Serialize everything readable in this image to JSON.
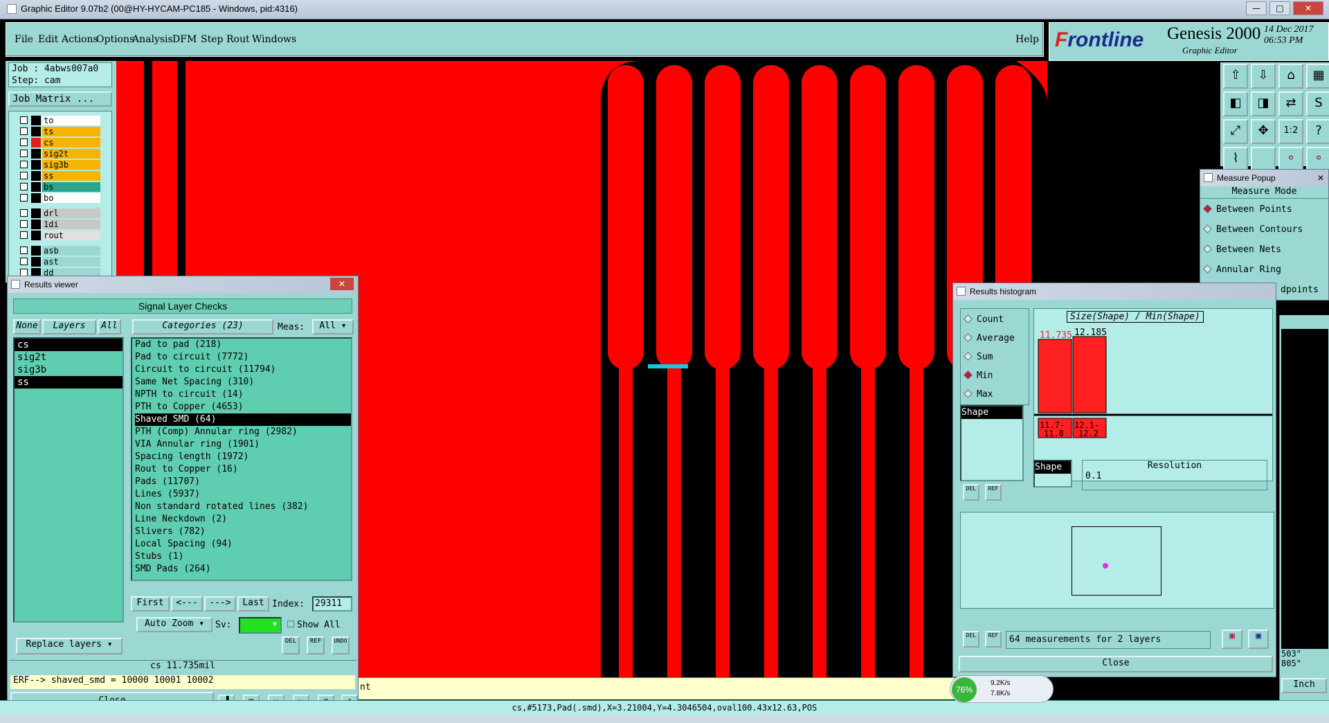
{
  "window": {
    "title": "Graphic Editor 9.07b2 (00@HY-HYCAM-PC185 - Windows, pid:4316)"
  },
  "menu": [
    "File",
    "Edit",
    "Actions",
    "Options",
    "Analysis",
    "DFM",
    "Step",
    "Rout",
    "Windows"
  ],
  "help": "Help",
  "brand": {
    "logo_a": "F",
    "logo_b": "rontline",
    "product": "Genesis 2000",
    "sub": "Graphic Editor",
    "date": "14 Dec 2017",
    "time": "06:53 PM"
  },
  "job": {
    "job_line": "Job : 4abws007a0",
    "step_line": "Step: cam",
    "matrix_btn": "Job Matrix ..."
  },
  "layers": [
    {
      "name": "to",
      "color": "#ffffff",
      "box": "#000000"
    },
    {
      "name": "ts",
      "color": "#f5b400",
      "box": "#000000"
    },
    {
      "name": "cs",
      "color": "#f5b400",
      "box": "#e0201a"
    },
    {
      "name": "sig2t",
      "color": "#f5b400",
      "box": "#000000"
    },
    {
      "name": "sig3b",
      "color": "#f5b400",
      "box": "#000000"
    },
    {
      "name": "ss",
      "color": "#f5b400",
      "box": "#000000"
    },
    {
      "name": "bs",
      "color": "#2aa690",
      "box": "#000000"
    },
    {
      "name": "bo",
      "color": "#ffffff",
      "box": "#000000"
    },
    {
      "name": "drl",
      "color": "#c8c8c8",
      "box": "#000000"
    },
    {
      "name": "1di",
      "color": "#c8c8c8",
      "box": "#000000"
    },
    {
      "name": "rout",
      "color": "#e0e0e0",
      "box": "#000000"
    },
    {
      "name": "asb",
      "color": "#9bd8d4",
      "box": "#000000"
    },
    {
      "name": "ast",
      "color": "#9bd8d4",
      "box": "#000000"
    },
    {
      "name": "dd",
      "color": "#9bd8d4",
      "box": "#000000"
    }
  ],
  "results_viewer": {
    "title": "Results viewer",
    "header": "Signal Layer Checks",
    "tab_none": "None",
    "tab_layers": "Layers",
    "tab_all": "All",
    "layer_list": [
      "cs",
      "sig2t",
      "sig3b",
      "ss"
    ],
    "categories_label": "Categories (23)",
    "meas_label": "Meas:",
    "meas_value": "All",
    "categories": [
      "Pad to pad (218)",
      "Pad to circuit (7772)",
      "Circuit to circuit (11794)",
      "Same Net Spacing (310)",
      "NPTH to circuit (14)",
      "PTH to Copper (4653)",
      "Shaved SMD (64)",
      "PTH (Comp) Annular ring (2982)",
      "VIA Annular ring (1901)",
      "Spacing length (1972)",
      "Rout to Copper (16)",
      "Pads (11707)",
      "Lines (5937)",
      "Non standard rotated lines (382)",
      "Line Neckdown (2)",
      "Slivers (782)",
      "Local Spacing (94)",
      "Stubs (1)",
      "SMD Pads (264)"
    ],
    "first": "First",
    "prev": "<---",
    "next": "--->",
    "last": "Last",
    "index_label": "Index:",
    "index_value": "29311",
    "zoom": "Auto Zoom",
    "sv": "Sv:",
    "show_all": "Show All",
    "replace": "Replace layers",
    "del": "DEL",
    "ref": "REF",
    "undo": "UNDO",
    "result_line": "cs 11.735mil",
    "erf_line": "ERF--> shaved_smd = 10000 10001 10002",
    "close": "Close"
  },
  "histogram": {
    "title": "Results histogram",
    "modes": [
      "Count",
      "Average",
      "Sum",
      "Min",
      "Max"
    ],
    "selected_mode": "Min",
    "chart_title": "Size(Shape) / Min(Shape)",
    "shape_label": "Shape",
    "resolution_label": "Resolution",
    "resolution_value": "0.1",
    "summary": "64 measurements for 2 layers",
    "close": "Close",
    "del": "DEL",
    "ref": "REF"
  },
  "chart_data": {
    "type": "bar",
    "title": "Size(Shape) / Min(Shape)",
    "categories": [
      "11.7-11.8",
      "12.1-12.2"
    ],
    "values": [
      11.735,
      12.185
    ],
    "bin_labels_top": [
      "11.7-",
      "12.1-"
    ],
    "bin_labels_bottom": [
      "11.8",
      "12.2"
    ]
  },
  "measure": {
    "title": "Measure Popup",
    "mode_header": "Measure Mode",
    "options": [
      "Between Points",
      "Between Contours",
      "Between Nets",
      "Annular Ring"
    ],
    "selected": "Between Points",
    "partial": "dpoints"
  },
  "right_edge": {
    "val1": "503\"",
    "val2": "805\"",
    "unit": "Inch"
  },
  "status": {
    "coord": "cs,#5173,Pad(.smd),X=3.21004,Y=4.3046504,oval100.43x12.63,POS",
    "partial": "nt"
  },
  "net": {
    "pct": "76%",
    "up": "9.2K/s",
    "down": "7.8K/s"
  },
  "colors": {
    "copper": "#ff0000",
    "bg": "#000000",
    "panel": "#9bd8d4",
    "highlight": "#19c8dc"
  }
}
